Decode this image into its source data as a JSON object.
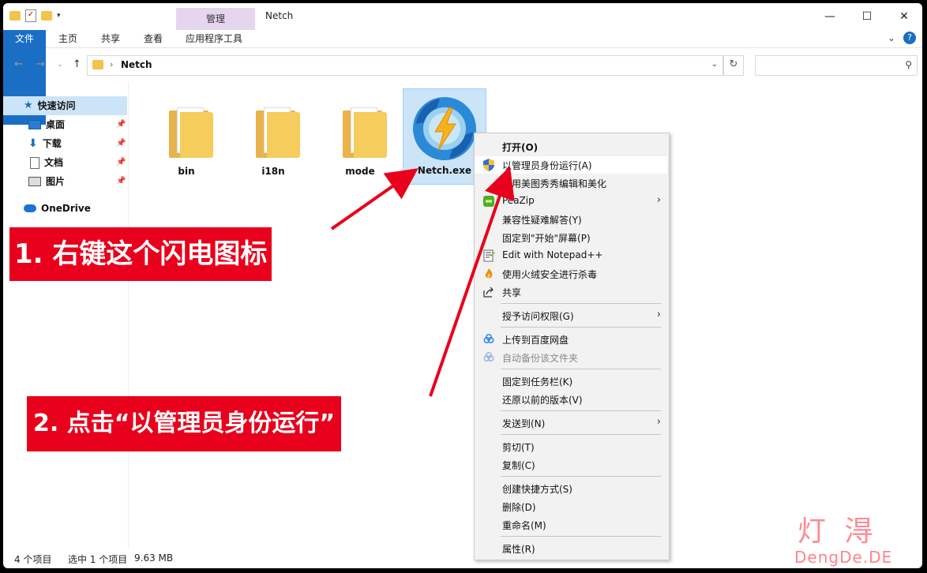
{
  "window": {
    "title": "Netch",
    "context_tab": "管理",
    "controls": [
      "—",
      "☐",
      "✕"
    ]
  },
  "ribbon": {
    "tabs": [
      "文件",
      "主页",
      "共享",
      "查看",
      "应用程序工具"
    ],
    "collapse": "⌄",
    "help": "?"
  },
  "address": {
    "path": "Netch",
    "back": "←",
    "forward": "→",
    "up": "↑",
    "dropdown": "⌄",
    "refresh": "↻",
    "search_placeholder": ""
  },
  "sidebar": {
    "quick_access": "快速访问",
    "items": [
      {
        "label": "桌面",
        "icon": "desktop-icon",
        "pinned": true
      },
      {
        "label": "下载",
        "icon": "download-icon",
        "pinned": true
      },
      {
        "label": "文档",
        "icon": "document-icon",
        "pinned": true
      },
      {
        "label": "图片",
        "icon": "pictures-icon",
        "pinned": true
      }
    ],
    "onedrive": "OneDrive"
  },
  "files": [
    {
      "name": "bin",
      "type": "folder",
      "selected": false
    },
    {
      "name": "i18n",
      "type": "folder",
      "selected": false
    },
    {
      "name": "mode",
      "type": "folder",
      "selected": false
    },
    {
      "name": "Netch.exe",
      "type": "exe",
      "selected": true
    }
  ],
  "context_menu": {
    "items": [
      {
        "label": "打开(O)",
        "icon": "",
        "bold": true
      },
      {
        "label": "以管理员身份运行(A)",
        "icon": "uac-shield-icon",
        "highlight": true
      },
      {
        "label": "使用美图秀秀编辑和美化",
        "icon": ""
      },
      {
        "label": "PeaZip",
        "icon": "peazip-icon",
        "submenu": true
      },
      {
        "label": "兼容性疑难解答(Y)",
        "icon": ""
      },
      {
        "label": "固定到\"开始\"屏幕(P)",
        "icon": ""
      },
      {
        "label": "Edit with Notepad++",
        "icon": "notepad-plus-plus-icon"
      },
      {
        "label": "使用火绒安全进行杀毒",
        "icon": "huorong-icon"
      },
      {
        "label": "共享",
        "icon": "share-icon"
      },
      {
        "label": "授予访问权限(G)",
        "icon": "",
        "submenu": true
      },
      {
        "label": "上传到百度网盘",
        "icon": "baidu-netdisk-icon"
      },
      {
        "label": "自动备份该文件夹",
        "icon": "baidu-netdisk-icon",
        "disabled": true
      },
      {
        "label": "固定到任务栏(K)",
        "icon": ""
      },
      {
        "label": "还原以前的版本(V)",
        "icon": ""
      },
      {
        "label": "发送到(N)",
        "icon": "",
        "submenu": true
      },
      {
        "label": "剪切(T)",
        "icon": ""
      },
      {
        "label": "复制(C)",
        "icon": ""
      },
      {
        "label": "创建快捷方式(S)",
        "icon": ""
      },
      {
        "label": "删除(D)",
        "icon": ""
      },
      {
        "label": "重命名(M)",
        "icon": ""
      },
      {
        "label": "属性(R)",
        "icon": ""
      }
    ],
    "submenu_arrow": "›"
  },
  "status": {
    "count": "4 个项目",
    "selected": "选中 1 个项目",
    "size": "9.63 MB"
  },
  "annotations": {
    "step1": "1. 右键这个闪电图标",
    "step2": "2. 点击“以管理员身份运行”",
    "color": "#e8001c"
  },
  "watermark": {
    "cn": "灯 淂",
    "en": "DengDe.DE"
  },
  "colors": {
    "accent": "#1a6fc4",
    "selection": "#cce4f7",
    "manage_tab": "#e6d5ee",
    "arrow": "#e8001c"
  }
}
